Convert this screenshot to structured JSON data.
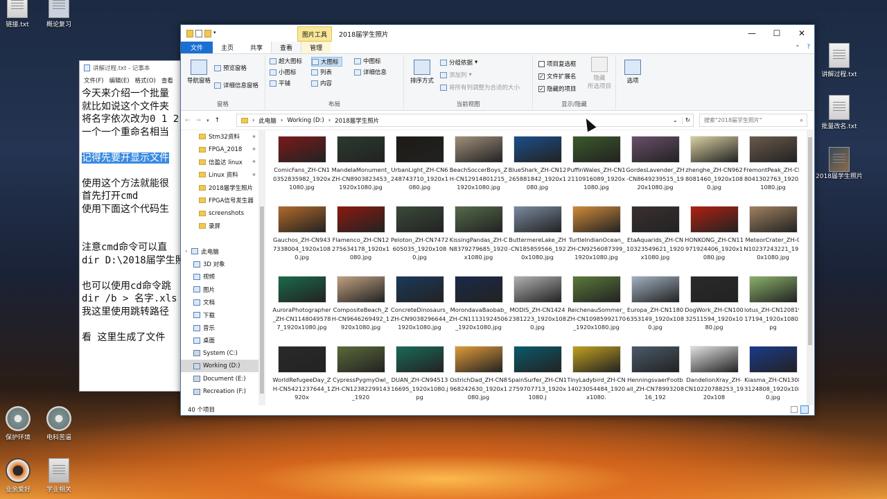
{
  "desktop": {
    "left_icons": [
      {
        "label": "链接.txt",
        "icon": "text-file-icon"
      },
      {
        "label": "概论复习",
        "icon": "folder-icon"
      }
    ],
    "bottom_icons": [
      {
        "label": "保护环境",
        "icon": "disc-icon"
      },
      {
        "label": "电科苦逼",
        "icon": "disc-icon"
      },
      {
        "label": "业余爱好",
        "icon": "lifebuoy-icon"
      },
      {
        "label": "学业相关",
        "icon": "clipboard-icon"
      }
    ],
    "right_icons": [
      {
        "label": "讲解过程.txt",
        "icon": "text-file-icon"
      },
      {
        "label": "批量改名.txt",
        "icon": "text-file-icon"
      },
      {
        "label": "2018届学生照片",
        "icon": "photo-folder-icon"
      }
    ]
  },
  "notepad": {
    "title": "讲解过程.txt - 记事本",
    "menu": [
      "文件(F)",
      "编辑(E)",
      "格式(O)",
      "查看"
    ],
    "lines": [
      "今天来介绍一个批量",
      "就比如说这个文件夹",
      "将名字依次改为0 1 2",
      " 一个一个重命名相当",
      "",
      "记得先要开显示文件",
      "",
      "使用这个方法就能很",
      "首先打开cmd",
      "使用下面这个代码生",
      "",
      "",
      "注意cmd命令可以直",
      "dir D:\\2018届学生照",
      "",
      "也可以使用cd命令跳",
      "dir /b > 名字.xls",
      "我这里使用跳转路径",
      "",
      "看 这里生成了文件"
    ],
    "selected_line_index": 5
  },
  "explorer": {
    "context_tab": "图片工具",
    "title": "2018届学生照片",
    "tabs": [
      "文件",
      "主页",
      "共享",
      "查看",
      "管理"
    ],
    "active_tab": "查看",
    "ribbon": {
      "panes": {
        "nav_pane": "导航窗格",
        "preview": "预览窗格",
        "details": "详细信息窗格",
        "label": "窗格"
      },
      "layout": {
        "items": [
          "超大图标",
          "大图标",
          "中图标",
          "小图标",
          "列表",
          "详细信息",
          "平铺",
          "内容"
        ],
        "selected": "大图标",
        "label": "布局"
      },
      "current_view": {
        "sort": "排序方式",
        "group": "分组依据",
        "add_col": "添加列",
        "fit": "将所有列调整为合适的大小",
        "label": "当前视图"
      },
      "show_hide": {
        "item_checkbox": "项目复选框",
        "file_ext": "文件扩展名",
        "hidden_items": "隐藏的项目",
        "hide_selected": "隐藏",
        "hide_selected2": "所选项目",
        "label": "显示/隐藏",
        "checks": [
          false,
          true,
          true
        ]
      },
      "options": "选项"
    },
    "breadcrumb": [
      "此电脑",
      "Working (D:)",
      "2018届学生照片"
    ],
    "search_placeholder": "搜索\"2018届学生照片\"",
    "nav_items": [
      {
        "label": "Stm32资料",
        "pinned": true,
        "icon": "folder-icon"
      },
      {
        "label": "FPGA_2018",
        "pinned": true,
        "icon": "folder-icon"
      },
      {
        "label": "信盈达 linux",
        "pinned": true,
        "icon": "folder-icon"
      },
      {
        "label": "Linux 资料",
        "pinned": true,
        "icon": "folder-icon"
      },
      {
        "label": "2018届学生照片",
        "pinned": false,
        "icon": "folder-icon"
      },
      {
        "label": "FPGA信号发生器",
        "pinned": false,
        "icon": "folder-icon"
      },
      {
        "label": "screenshots",
        "pinned": false,
        "icon": "folder-icon"
      },
      {
        "label": "录屏",
        "pinned": false,
        "icon": "folder-icon"
      },
      {
        "label": "",
        "pinned": false,
        "icon": ""
      },
      {
        "label": "此电脑",
        "pinned": false,
        "icon": "computer-icon"
      },
      {
        "label": "3D 对象",
        "pinned": false,
        "icon": "cube-icon"
      },
      {
        "label": "视频",
        "pinned": false,
        "icon": "video-icon"
      },
      {
        "label": "图片",
        "pinned": false,
        "icon": "picture-icon"
      },
      {
        "label": "文档",
        "pinned": false,
        "icon": "document-icon"
      },
      {
        "label": "下载",
        "pinned": false,
        "icon": "download-icon"
      },
      {
        "label": "音乐",
        "pinned": false,
        "icon": "music-icon"
      },
      {
        "label": "桌面",
        "pinned": false,
        "icon": "desktop-icon"
      },
      {
        "label": "System (C:)",
        "pinned": false,
        "icon": "drive-icon"
      },
      {
        "label": "Working (D:)",
        "pinned": false,
        "icon": "drive-icon"
      },
      {
        "label": "Document (E:)",
        "pinned": false,
        "icon": "drive-icon"
      },
      {
        "label": "Recreation (F:)",
        "pinned": false,
        "icon": "drive-icon"
      },
      {
        "label": "",
        "pinned": false,
        "icon": ""
      },
      {
        "label": "网络",
        "pinned": false,
        "icon": "network-icon"
      }
    ],
    "selected_nav": "Working (D:)",
    "files": [
      {
        "name": "ComicFans_ZH-CN10352835982_1920x1080.jpg",
        "c": "#7a1a1a"
      },
      {
        "name": "MandelaMonument_ZH-CN8903823453_1920x1080.jpg",
        "c": "#2b3b2e"
      },
      {
        "name": "UrbanLight_ZH-CN6248743710_1920x1080.jpg",
        "c": "#1d1a14"
      },
      {
        "name": "BeachSoccerBoys_ZH-CN12914801215_1920x1080.jpg",
        "c": "#a08f7a"
      },
      {
        "name": "BlueShark_ZH-CN12265881842_1920x1080.jpg",
        "c": "#1b4f8a"
      },
      {
        "name": "PuffinWales_ZH-CN12110916089_1920x1080.jpg",
        "c": "#3a5a2a"
      },
      {
        "name": "GordesLavender_ZH-CN8649239515_1920x1080.jpg",
        "c": "#6a4f6a"
      },
      {
        "name": "zhenghe_ZH-CN9628081460_1920x1080.jpg",
        "c": "#d8cfa0"
      },
      {
        "name": "FremontPeak_ZH-CN8041302763_1920x1080.jpg",
        "c": "#6a5a4a"
      },
      {
        "name": "Gauchos_ZH-CN9437338004_1920x1080.jpg",
        "c": "#b06a2a"
      },
      {
        "name": "Flamenco_ZH-CN12275634178_1920x1080.jpg",
        "c": "#8a1a10"
      },
      {
        "name": "Peloton_ZH-CN7472605035_1920x1080.jpg",
        "c": "#3a4a3a"
      },
      {
        "name": "KissingPandas_ZH-CN8379279685_1920x1080.jpg",
        "c": "#556a4a"
      },
      {
        "name": "ButtermereLake_ZH-CN185859566_1920x1080.jpg",
        "c": "#7a8aa0"
      },
      {
        "name": "TurtleIndianOcean_ZH-CN9256087399_1920x1080.jpg",
        "c": "#d08a3a"
      },
      {
        "name": "EtaAquarids_ZH-CN10323549621_1920x1080.jpg",
        "c": "#3a3030"
      },
      {
        "name": "HONKONG_ZH-CN11971924406_1920x1080.jpg",
        "c": "#b02010"
      },
      {
        "name": "MeteorCrater_ZH-CN10237243221_1920x1080.jpg",
        "c": "#a08060"
      },
      {
        "name": "AuroraPhotographer_ZH-CN11480495787_1920x1080.jpg",
        "c": "#1a6a4a"
      },
      {
        "name": "CompositeBeach_ZH-CN9646269492_1920x1080.jpg",
        "c": "#c0a080"
      },
      {
        "name": "ConcreteDinosaurs_ZH-CN9038296644_1920x1080.jpg",
        "c": "#1a3a5a"
      },
      {
        "name": "MorondavaBaobab_ZH-CN11131924506_1920x1080.jpg",
        "c": "#1a2a4a"
      },
      {
        "name": "MODIS_ZH-CN14242381223_1920x1080.jpg",
        "c": "#b0b0b0"
      },
      {
        "name": "ReichenauSommer_ZH-CN10985992170_1920x1080.jpg",
        "c": "#5a7a3a"
      },
      {
        "name": "Europa_ZH-CN11806353149_1920x1080.jpg",
        "c": "#a0b0c0"
      },
      {
        "name": "DogWork_ZH-CN10032511594_1920x1080.jpg",
        "c": "#2a2a2a"
      },
      {
        "name": "lotus_ZH-CN12081917194_1920x1080.jpg",
        "c": "#8ab06a"
      },
      {
        "name": "WorldRefugeeDay_ZH-CN5421237644_1920x",
        "c": "#2a2a2a"
      },
      {
        "name": "CypressPygmyOwl_ZH-CN12382299143_1920",
        "c": "#5a6a3a"
      },
      {
        "name": "DUAN_ZH-CN9451316695_1920x1080.jpg",
        "c": "#1a6a5a"
      },
      {
        "name": "OstrichDad_ZH-CN8968242630_1920x1080.jpg",
        "c": "#e09a3a"
      },
      {
        "name": "SpainSurfer_ZH-CN12759707713_1920x1080.j",
        "c": "#0a5a6a"
      },
      {
        "name": "TinyLadybird_ZH-CN14023054484_1920x1080.",
        "c": "#c0a020"
      },
      {
        "name": "HenningsvaerFootball_ZH-CN7899320816_192",
        "c": "#4a5a6a"
      },
      {
        "name": "DandelionXray_ZH-CN10220788253_1920x108",
        "c": "#e0e0e0"
      },
      {
        "name": "Kiasma_ZH-CN13083124808_1920x1080.jpg",
        "c": "#1a3a8a"
      }
    ],
    "status": "40 个项目"
  }
}
